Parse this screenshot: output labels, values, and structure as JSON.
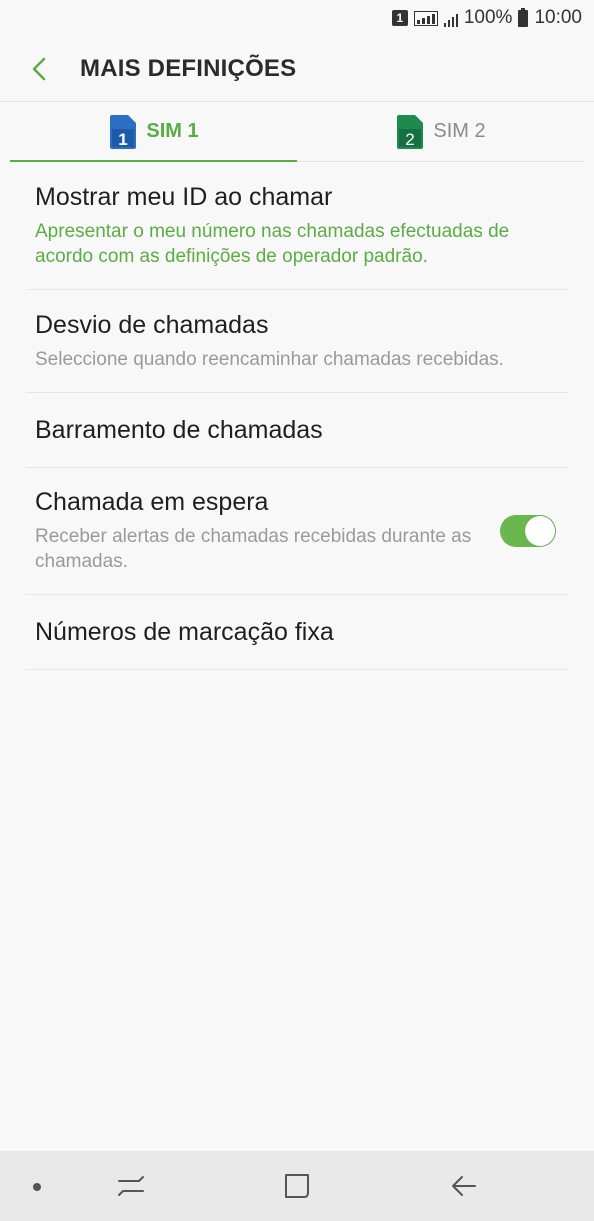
{
  "status_bar": {
    "sim_number": "1",
    "battery": "100%",
    "time": "10:00"
  },
  "header": {
    "title": "MAIS DEFINIÇÕES",
    "back_icon": "chevron-left-icon"
  },
  "tabs": [
    {
      "label": "SIM 1",
      "sim_number": "1",
      "active": true,
      "color": "#2a6fc4"
    },
    {
      "label": "SIM 2",
      "sim_number": "2",
      "active": false,
      "color": "#1e8a4f"
    }
  ],
  "settings": {
    "caller_id": {
      "title": "Mostrar meu ID ao chamar",
      "subtitle": "Apresentar o meu número nas chamadas efectuadas de acordo com as definições de operador padrão."
    },
    "call_forwarding": {
      "title": "Desvio de chamadas",
      "subtitle": "Seleccione quando reencaminhar chamadas recebidas."
    },
    "call_barring": {
      "title": "Barramento de chamadas"
    },
    "call_waiting": {
      "title": "Chamada em espera",
      "subtitle": "Receber alertas de chamadas recebidas durante as chamadas.",
      "enabled": true
    },
    "fixed_dialing": {
      "title": "Números de marcação fixa"
    }
  },
  "colors": {
    "accent": "#5aad44",
    "background": "#f8f8f8",
    "nav_bar": "#e9e9e9"
  }
}
